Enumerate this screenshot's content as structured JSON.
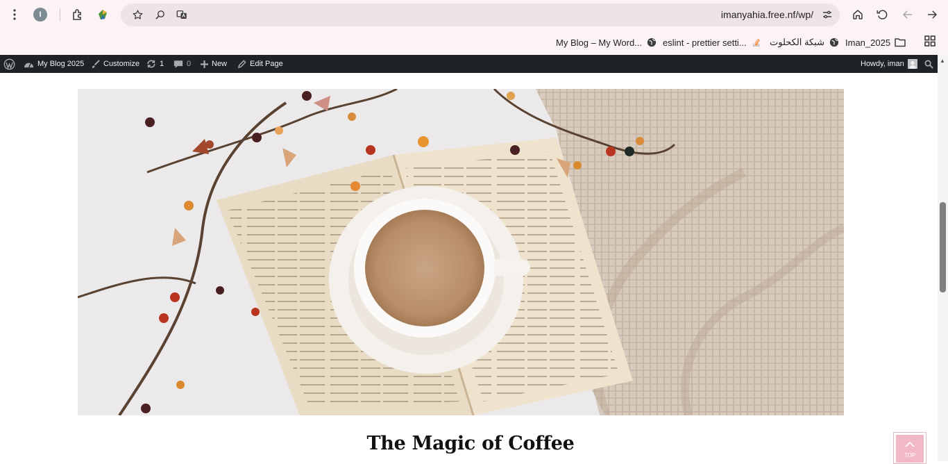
{
  "browser": {
    "url": "imanyahia.free.nf/wp/",
    "profile_initial": "I",
    "bookmarks": [
      {
        "label": "My Blog – My Word...",
        "icon": "globe-icon"
      },
      {
        "label": "eslint - prettier setti...",
        "icon": "stackoverflow-icon"
      },
      {
        "label": "شبكة الكحلوت",
        "icon": "globe-icon"
      },
      {
        "label": "Iman_2025",
        "icon": "folder-icon"
      }
    ]
  },
  "adminbar": {
    "site_name": "My Blog 2025",
    "customize": "Customize",
    "updates_count": "1",
    "comments_count": "0",
    "new": "New",
    "edit_page": "Edit Page",
    "howdy": "Howdy, iman"
  },
  "post": {
    "title": "The Magic of Coffee",
    "image": "coffee-cup-on-open-book-photo"
  },
  "back_to_top": {
    "label": "TOP"
  },
  "colors": {
    "browser_chrome": "#fcf3f7",
    "omnibox": "#efe3ea",
    "adminbar": "#1d2327",
    "back_to_top": "#f2b8c6"
  }
}
